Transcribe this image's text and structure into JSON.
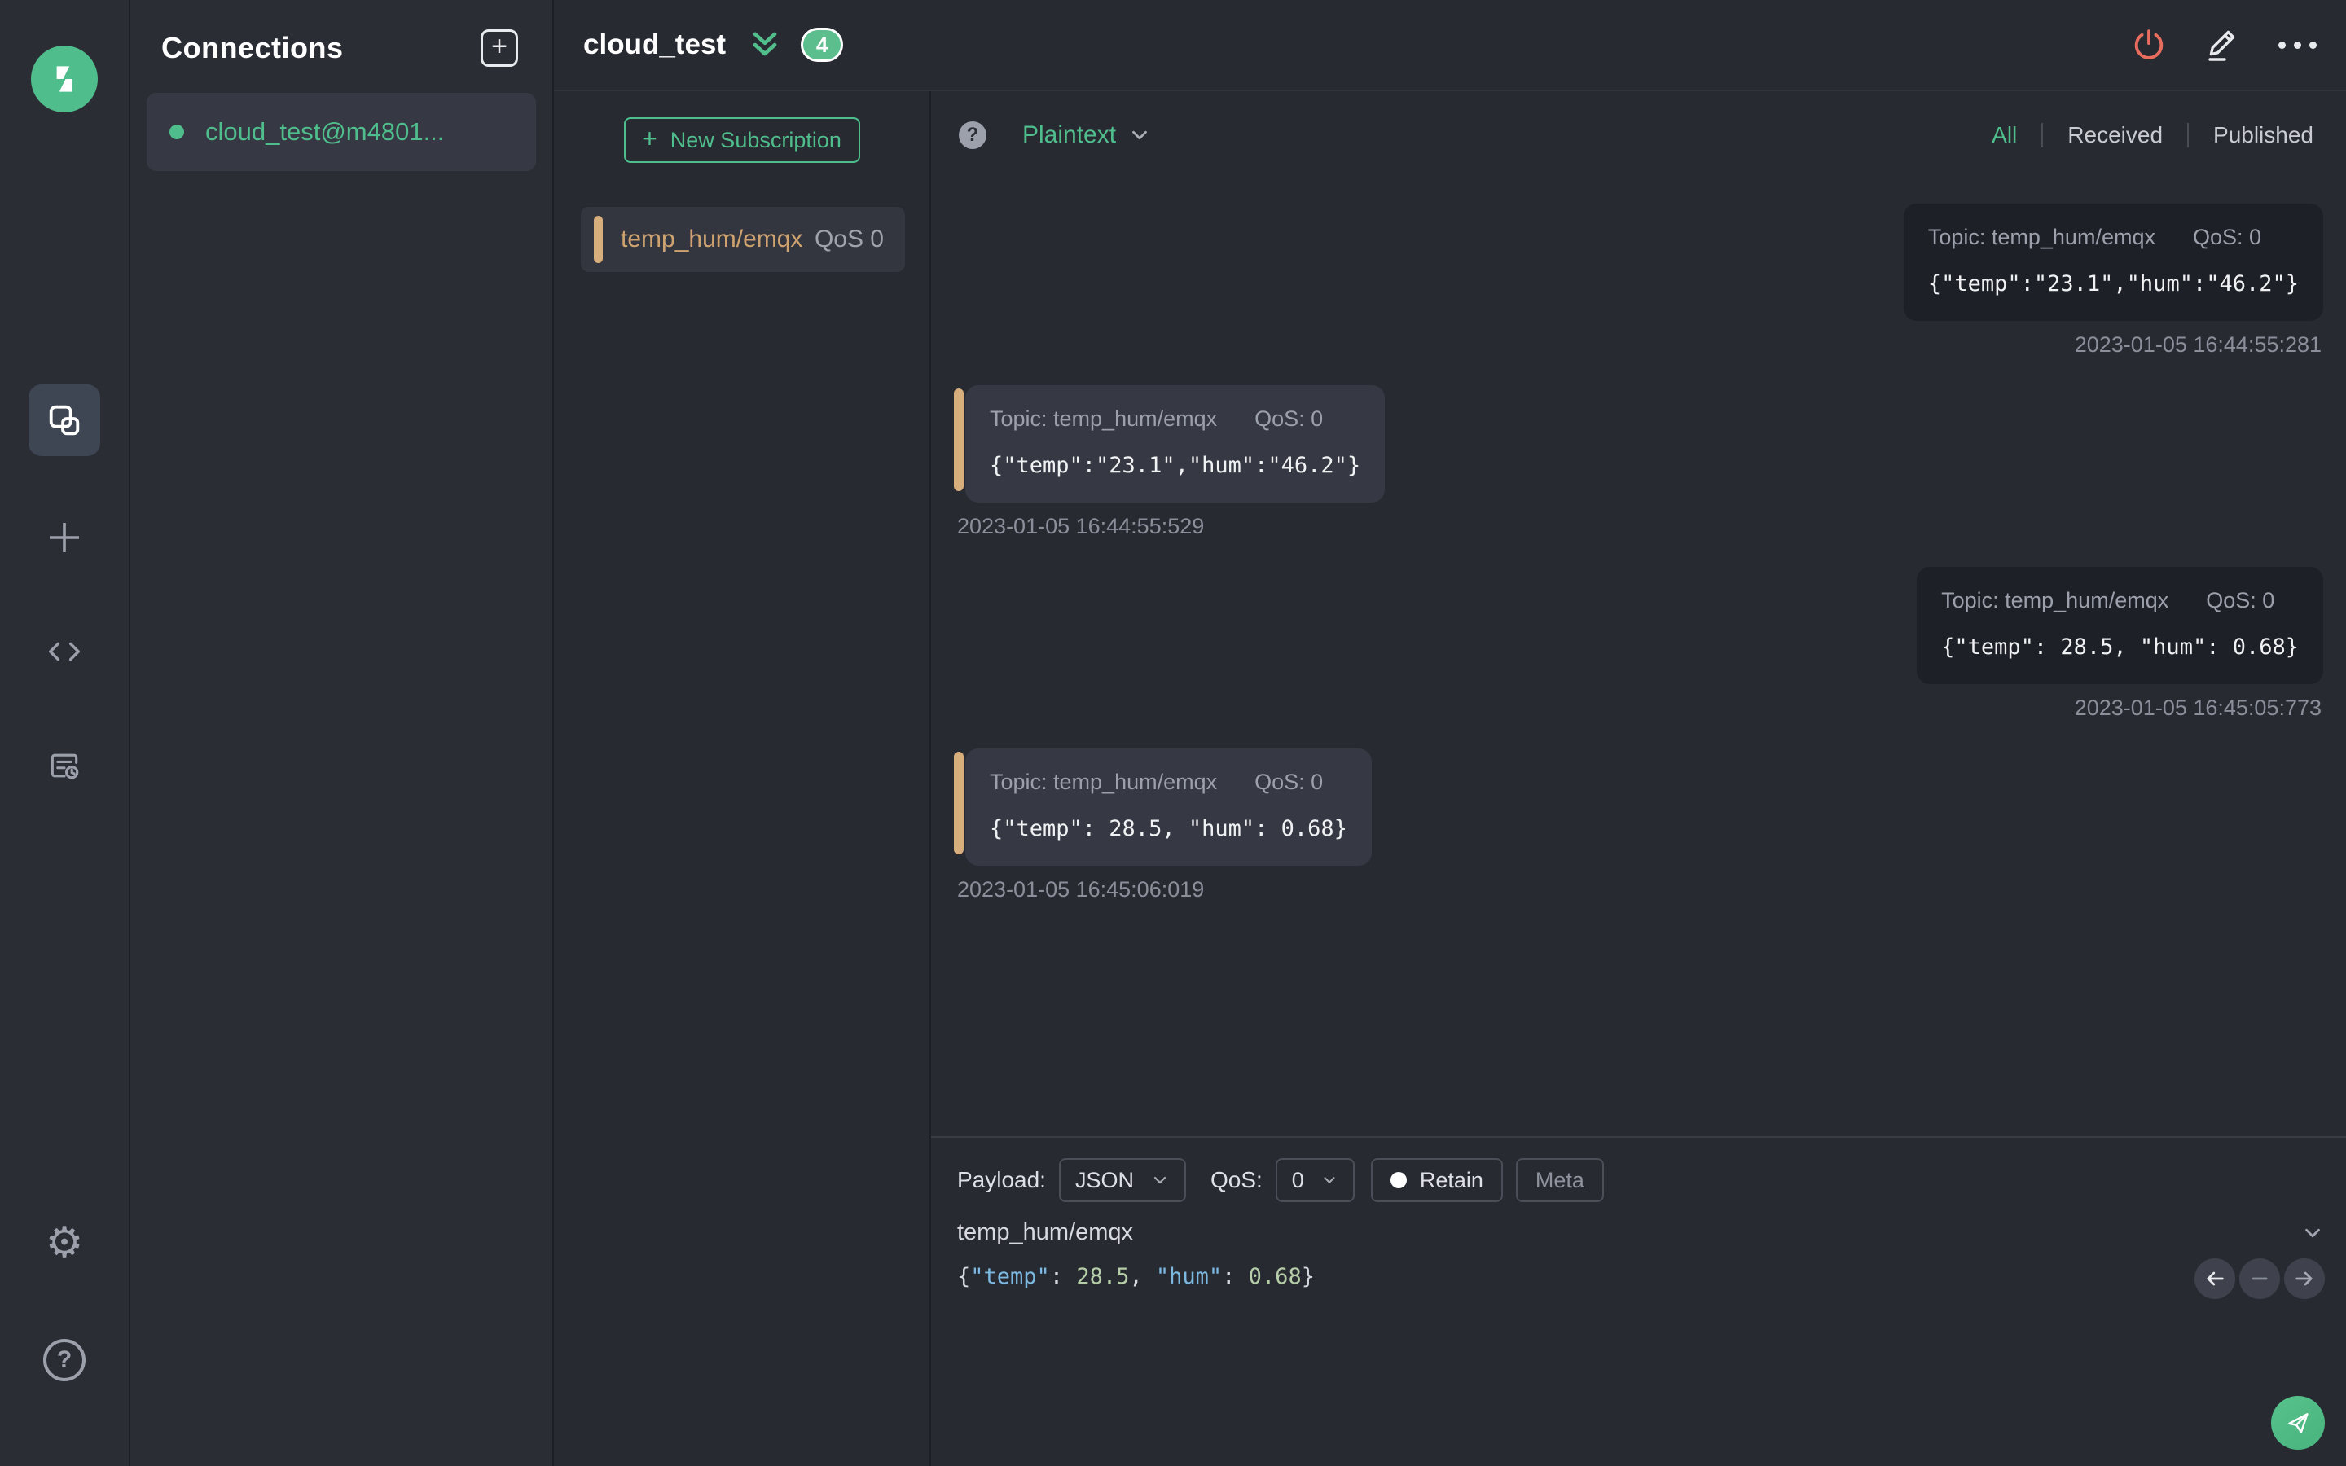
{
  "colors": {
    "accent_green": "#4FBE8C",
    "topic_orange": "#CFA36F",
    "bar_orange": "#D8AE7C",
    "power_red": "#E96D5F",
    "syntax_key": "#7CB8E0",
    "syntax_number": "#B5CEA8"
  },
  "sidebar": {
    "icons": [
      "mqttx-logo",
      "connections",
      "new-connection-plus",
      "script",
      "log",
      "settings-gear",
      "help"
    ],
    "gear_glyph": "⚙",
    "help_glyph": "?"
  },
  "connections": {
    "title": "Connections",
    "items": [
      {
        "name": "cloud_test@m4801...",
        "status_color": "#4FBE8C"
      }
    ]
  },
  "header": {
    "title": "cloud_test",
    "badge_count": "4"
  },
  "subscriptions": {
    "new_button_label": "New Subscription",
    "items": [
      {
        "topic": "temp_hum/emqx",
        "qos": "QoS 0"
      }
    ]
  },
  "messages": {
    "help_glyph": "?",
    "view_mode": "Plaintext",
    "filters": {
      "all": "All",
      "received": "Received",
      "published": "Published",
      "active": "All"
    },
    "items": [
      {
        "direction": "published",
        "topic_label": "Topic: temp_hum/emqx",
        "qos_label": "QoS: 0",
        "payload": "{\"temp\":\"23.1\",\"hum\":\"46.2\"}",
        "timestamp": "2023-01-05 16:44:55:281"
      },
      {
        "direction": "received",
        "topic_label": "Topic: temp_hum/emqx",
        "qos_label": "QoS: 0",
        "payload": "{\"temp\":\"23.1\",\"hum\":\"46.2\"}",
        "timestamp": "2023-01-05 16:44:55:529"
      },
      {
        "direction": "published",
        "topic_label": "Topic: temp_hum/emqx",
        "qos_label": "QoS: 0",
        "payload": "{\"temp\": 28.5, \"hum\": 0.68}",
        "timestamp": "2023-01-05 16:45:05:773"
      },
      {
        "direction": "received",
        "topic_label": "Topic: temp_hum/emqx",
        "qos_label": "QoS: 0",
        "payload": "{\"temp\": 28.5, \"hum\": 0.68}",
        "timestamp": "2023-01-05 16:45:06:019"
      }
    ]
  },
  "publish": {
    "payload_label": "Payload:",
    "payload_format": "JSON",
    "qos_label": "QoS:",
    "qos_value": "0",
    "retain_label": "Retain",
    "meta_label": "Meta",
    "topic": "temp_hum/emqx",
    "message": "{\"temp\": 28.5, \"hum\": 0.68}"
  }
}
